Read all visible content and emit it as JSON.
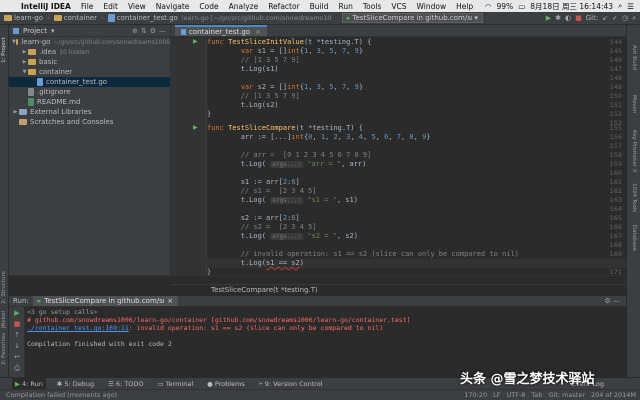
{
  "menubar": {
    "app": "IntelliJ IDEA",
    "items": [
      "File",
      "Edit",
      "View",
      "Navigate",
      "Code",
      "Analyze",
      "Refactor",
      "Build",
      "Run",
      "Tools",
      "VCS",
      "Window",
      "Help"
    ],
    "battery": "99%",
    "datetime": "8月18日 周三 16:14:43"
  },
  "navbar": {
    "project": "learn-go",
    "folder": "container",
    "file": "container_test.go",
    "window_title": "learn-go [~/go/src/github.com/snowdreams1006/learn-go] - .../container/container_test.go [learn-go]",
    "run_config": "TestSliceCompare in github.com/snowdreams1006/learn-go/container",
    "git_label": "Git:"
  },
  "project_pane": {
    "title": "Project",
    "items": [
      {
        "label": "learn-go",
        "dim": "~/go/src/github.com/snowdreams1006",
        "indent": 0,
        "type": "folder",
        "arrow": "▼"
      },
      {
        "label": ".idea",
        "dim": "10 hidden",
        "indent": 1,
        "type": "folder",
        "arrow": "▶"
      },
      {
        "label": "basic",
        "dim": "",
        "indent": 1,
        "type": "folder",
        "arrow": "▶"
      },
      {
        "label": "container",
        "dim": "",
        "indent": 1,
        "type": "folder",
        "arrow": "▼"
      },
      {
        "label": "container_test.go",
        "dim": "",
        "indent": 2,
        "type": "file-go",
        "arrow": ""
      },
      {
        "label": ".gitignore",
        "dim": "",
        "indent": 1,
        "type": "file-git",
        "arrow": ""
      },
      {
        "label": "README.md",
        "dim": "",
        "indent": 1,
        "type": "file-md",
        "arrow": ""
      },
      {
        "label": "External Libraries",
        "dim": "",
        "indent": 0,
        "type": "lib",
        "arrow": "▶"
      },
      {
        "label": "Scratches and Consoles",
        "dim": "",
        "indent": 0,
        "type": "scratch",
        "arrow": ""
      }
    ]
  },
  "editor": {
    "tab": "container_test.go",
    "breadcrumb": "TestSliceCompare(t *testing.T)"
  },
  "left_strip": {
    "project": "1: Project",
    "structure": "2: Structure",
    "jrebel": "JRebel",
    "favorites": "2: Favorites"
  },
  "right_strip": [
    "Ant Build",
    "Maven",
    "Key Promoter X",
    "1024 Tools",
    "Database"
  ],
  "run_panel": {
    "label": "Run:",
    "tab": "TestSliceCompare in github.com/snowdreams1006/learn-go/container",
    "console": [
      {
        "text": "<3 go setup calls>",
        "style": "gray"
      },
      {
        "text": "# github.com/snowdreams1006/learn-go/container [github.com/snowdreams1006/learn-go/container.test]",
        "style": "red"
      },
      {
        "text": "./container_test.go:169:11: invalid operation: s1 == s2 (slice can only be compared to nil)",
        "style": "red",
        "link": "./container_test.go:169:11"
      },
      {
        "text": "",
        "style": "plain"
      },
      {
        "text": "Compilation finished with exit code 2",
        "style": "plain"
      }
    ]
  },
  "bottom_tabs": {
    "run": "4: Run",
    "debug": "5: Debug",
    "todo": "6: TODO",
    "terminal": "Terminal",
    "problems": "Problems",
    "vcs": "9: Version Control",
    "event_log": "Event Log"
  },
  "statusbar": {
    "message": "Compilation failed (moments ago)",
    "position": "170:20",
    "line_sep": "LF",
    "encoding": "UTF-8",
    "indent": "Tab",
    "git": "Git: master",
    "memory": "204 of 2014M"
  },
  "watermark": "头条 @雪之梦技术驿站"
}
